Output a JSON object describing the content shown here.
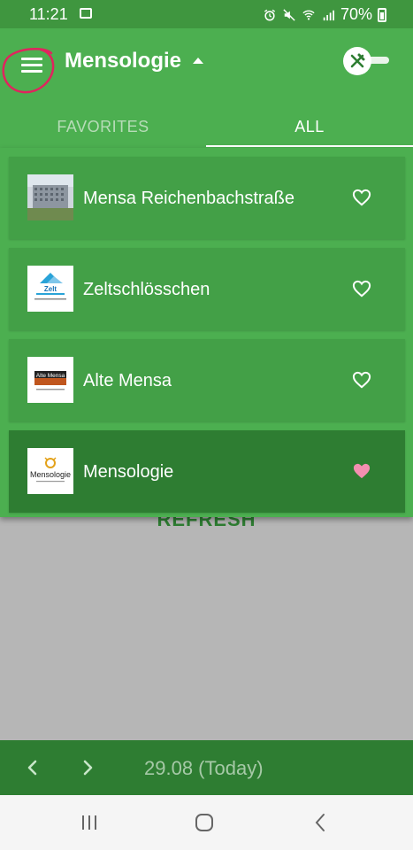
{
  "status_bar": {
    "time": "11:21",
    "battery": "70%",
    "icons": [
      "image-icon",
      "alarm-icon",
      "mute-icon",
      "wifi-icon",
      "signal-icon",
      "battery-icon"
    ]
  },
  "app_bar": {
    "title": "Mensologie",
    "menu_icon": "hamburger-menu-icon",
    "toggle_icon": "fork-knife-icon"
  },
  "tabs": [
    {
      "label": "FAVORITES",
      "active": false
    },
    {
      "label": "ALL",
      "active": true
    }
  ],
  "canteens": [
    {
      "name": "Mensa Reichenbachstraße",
      "favorite": false,
      "logo": "building-photo"
    },
    {
      "name": "Zeltschlösschen",
      "favorite": false,
      "logo": "zelt-schloesschen-logo",
      "logo_text": "Zelt"
    },
    {
      "name": "Alte Mensa",
      "favorite": false,
      "logo": "alte-mensa-logo",
      "logo_text": "Alte Mensa"
    },
    {
      "name": "Mensologie",
      "favorite": true,
      "selected": true,
      "logo": "mensologie-logo",
      "logo_text": "Mensologie"
    }
  ],
  "refresh_label": "REFRESH",
  "date_bar": {
    "date": "29.08 (Today)"
  },
  "colors": {
    "primary": "#4caf50",
    "primary_dark": "#2e7d32",
    "status_bar": "#3f963f",
    "favorite_heart": "#f48fb1",
    "annotation": "#e0245e"
  }
}
